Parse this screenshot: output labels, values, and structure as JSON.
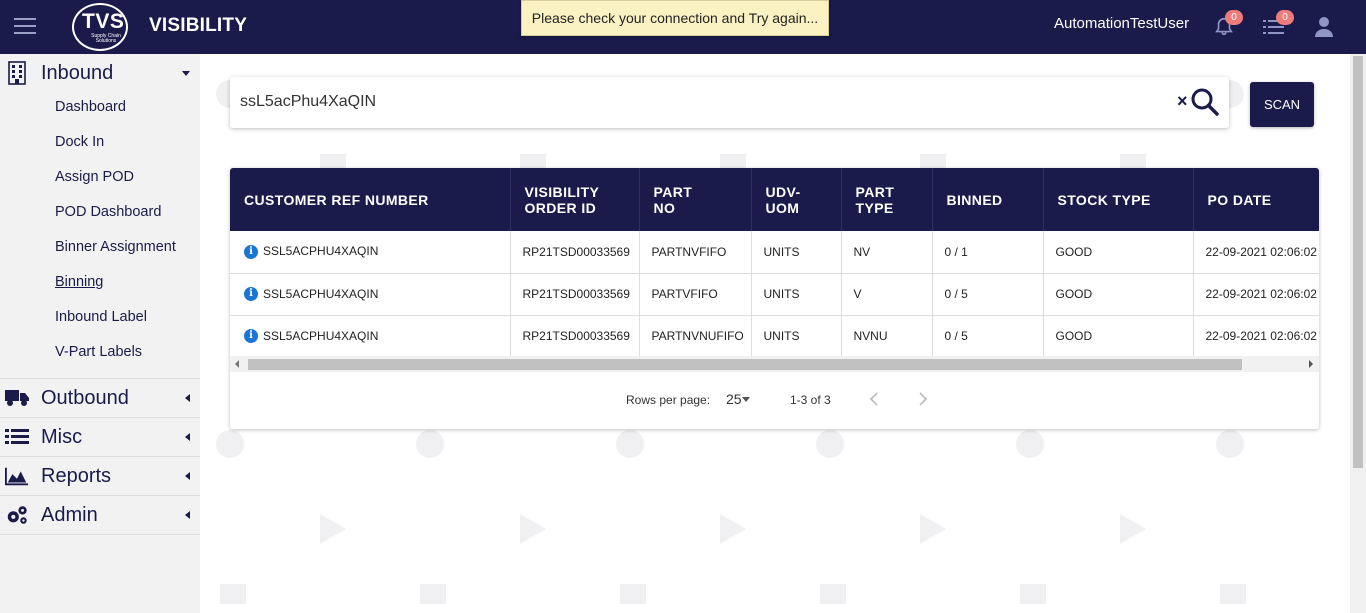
{
  "topbar": {
    "brand": "VISIBILITY",
    "logo_text": "TVS",
    "logo_sub": "Supply Chain Solutions",
    "toast": "Please check your connection and Try again...",
    "username": "AutomationTestUser",
    "notifications_count": "0",
    "tasks_count": "0"
  },
  "sidebar": {
    "inbound": {
      "label": "Inbound",
      "items": [
        "Dashboard",
        "Dock In",
        "Assign POD",
        "POD Dashboard",
        "Binner Assignment",
        "Binning",
        "Inbound Label",
        "V-Part Labels"
      ]
    },
    "outbound": {
      "label": "Outbound"
    },
    "misc": {
      "label": "Misc"
    },
    "reports": {
      "label": "Reports"
    },
    "admin": {
      "label": "Admin"
    }
  },
  "search": {
    "value": "ssL5acPhu4XaQIN",
    "clear": "×",
    "scan_label": "SCAN"
  },
  "table": {
    "headers": {
      "customer_ref": "CUSTOMER REF NUMBER",
      "visibility_order_1": "VISIBILITY",
      "visibility_order_2": "ORDER ID",
      "part_no_1": "PART",
      "part_no_2": "NO",
      "udv_uom_1": "UDV-",
      "udv_uom_2": "UOM",
      "part_type_1": "PART",
      "part_type_2": "TYPE",
      "binned": "BINNED",
      "stock_type": "STOCK TYPE",
      "po_date": "PO DATE"
    },
    "rows": [
      {
        "customer_ref": "SSL5ACPHU4XAQIN",
        "order_id": "RP21TSD00033569",
        "part_no": "PARTNVFIFO",
        "uom": "UNITS",
        "part_type": "NV",
        "binned": "0 / 1",
        "stock_type": "GOOD",
        "po_date": "22-09-2021 02:06:02"
      },
      {
        "customer_ref": "SSL5ACPHU4XAQIN",
        "order_id": "RP21TSD00033569",
        "part_no": "PARTVFIFO",
        "uom": "UNITS",
        "part_type": "V",
        "binned": "0 / 5",
        "stock_type": "GOOD",
        "po_date": "22-09-2021 02:06:02"
      },
      {
        "customer_ref": "SSL5ACPHU4XAQIN",
        "order_id": "RP21TSD00033569",
        "part_no": "PARTNVNUFIFO",
        "uom": "UNITS",
        "part_type": "NVNU",
        "binned": "0 / 5",
        "stock_type": "GOOD",
        "po_date": "22-09-2021 02:06:02"
      }
    ]
  },
  "pager": {
    "rows_per_page_label": "Rows per page:",
    "rows_per_page": "25",
    "range": "1-3 of 3"
  },
  "colors": {
    "primary": "#1b1b4b",
    "toast_bg": "#fbf2c3",
    "badge": "#ef7c7c",
    "info": "#1976d2"
  }
}
